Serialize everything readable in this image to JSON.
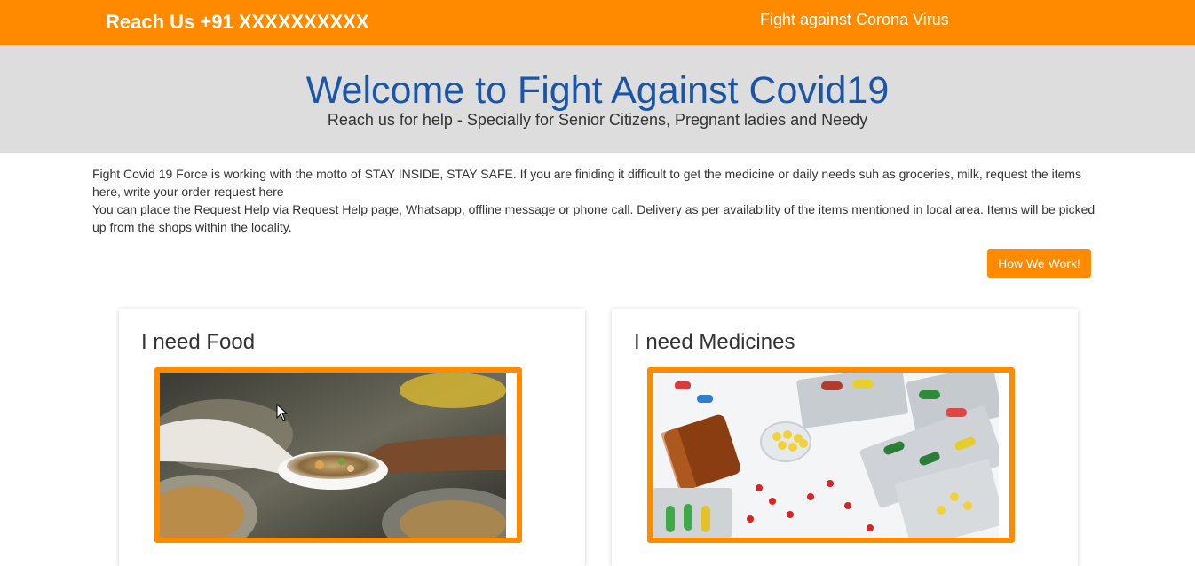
{
  "topbar": {
    "reach_label": "Reach Us +91 XXXXXXXXXX",
    "tagline": "Fight against Corona Virus"
  },
  "hero": {
    "title": "Welcome to Fight Against Covid19",
    "subtitle": "Reach us for help - Specially for Senior Citizens, Pregnant ladies and Needy"
  },
  "intro": {
    "paragraph_1": "Fight Covid 19 Force is working with the motto of STAY INSIDE, STAY SAFE. If you are finiding it difficult to get the medicine or daily needs suh as groceries, milk, request the items here, write your order request here",
    "paragraph_2": "You can place the Request Help via Request Help page, Whatsapp, offline message or phone call. Delivery as per availability of the items mentioned in local area. Items will be picked up from the shops within the locality."
  },
  "how_button": {
    "label": "How We Work!"
  },
  "cards": [
    {
      "title": "I need Food",
      "image": "food-donation-photo"
    },
    {
      "title": "I need Medicines",
      "image": "medicines-photo"
    }
  ],
  "colors": {
    "accent": "#ff8a00",
    "hero_bg": "#dddddd",
    "title_blue": "#1a55a8"
  }
}
